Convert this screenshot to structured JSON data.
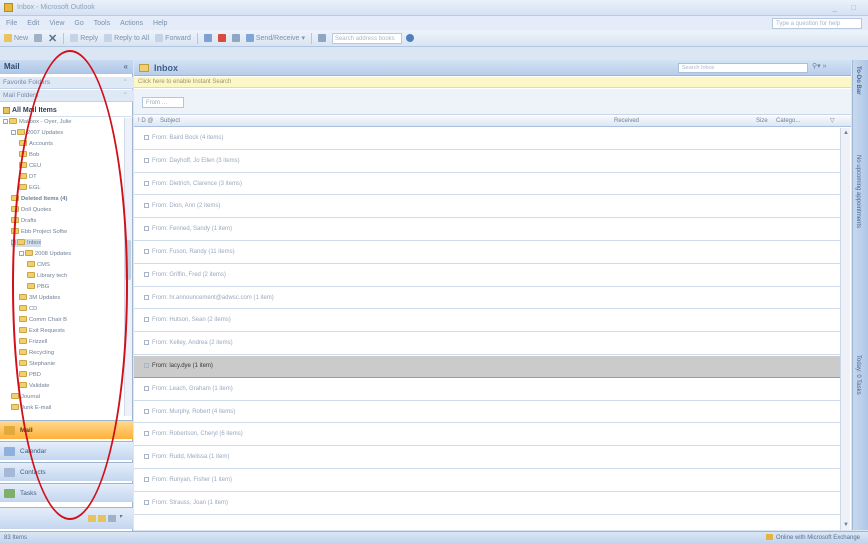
{
  "window": {
    "title": "Inbox - Microsoft Outlook"
  },
  "menu": [
    "File",
    "Edit",
    "View",
    "Go",
    "Tools",
    "Actions",
    "Help"
  ],
  "help_placeholder": "Type a question for help",
  "toolbar": {
    "new": "New",
    "reply": "Reply",
    "reply_all": "Reply to All",
    "forward": "Forward",
    "send_receive": "Send/Receive",
    "search_address_books": "Search address books"
  },
  "nav": {
    "title": "Mail",
    "favorite_folders": "Favorite Folders",
    "mail_folders": "Mail Folders",
    "all_mail_items": "All Mail Items",
    "folders": [
      {
        "label": "Mailbox - Oyer, Julie",
        "indent": 0,
        "toggle": "-"
      },
      {
        "label": "2007 Updates",
        "indent": 1,
        "toggle": "-"
      },
      {
        "label": "Accounts",
        "indent": 2
      },
      {
        "label": "Bob",
        "indent": 2
      },
      {
        "label": "CEU",
        "indent": 2
      },
      {
        "label": "DT",
        "indent": 2
      },
      {
        "label": "EGL",
        "indent": 2
      },
      {
        "label": "Deleted Items (4)",
        "indent": 1,
        "bold": true
      },
      {
        "label": "Doll Quotes",
        "indent": 1
      },
      {
        "label": "Drafts",
        "indent": 1
      },
      {
        "label": "Ebb Project Softw",
        "indent": 1
      },
      {
        "label": "Inbox",
        "indent": 1,
        "toggle": "-",
        "selected": true
      },
      {
        "label": "2008 Updates",
        "indent": 2,
        "toggle": "-"
      },
      {
        "label": "CMS",
        "indent": 3
      },
      {
        "label": "Library tech",
        "indent": 3
      },
      {
        "label": "PBG",
        "indent": 3
      },
      {
        "label": "3M Updates",
        "indent": 2
      },
      {
        "label": "CD",
        "indent": 2
      },
      {
        "label": "Comm Chair B",
        "indent": 2
      },
      {
        "label": "Exit Requests",
        "indent": 2
      },
      {
        "label": "Frizzell",
        "indent": 2
      },
      {
        "label": "Recycling",
        "indent": 2
      },
      {
        "label": "Stephanie",
        "indent": 2
      },
      {
        "label": "PBD",
        "indent": 2
      },
      {
        "label": "Validate",
        "indent": 2
      },
      {
        "label": "Journal",
        "indent": 1
      },
      {
        "label": "Junk E-mail",
        "indent": 1
      }
    ],
    "buttons": [
      "Mail",
      "Calendar",
      "Contacts",
      "Tasks"
    ]
  },
  "inbox": {
    "title": "Inbox",
    "search_placeholder": "Search Inbox",
    "infobar": "Click here to enable Instant Search",
    "filter_from": "From",
    "columns": {
      "icons": "! D @",
      "subject": "Subject",
      "received": "Received",
      "size": "Size",
      "categories": "Catego..."
    },
    "groups": [
      "From: Baird Bock (4 items)",
      "From: Dayhoff, Jo Ellen (3 items)",
      "From: Dietrich, Clarence (3 items)",
      "From: Dion, Ann (2 items)",
      "From: Fenned, Sandy (1 item)",
      "From: Fuson, Randy (11 items)",
      "From: Griffin, Fred (2 items)",
      "From: hr.announcement@adwsc.com (1 item)",
      "From: Hutson, Sean (2 items)",
      "From: Kelley, Andrea (2 items)",
      "From: lacy.dye (1 item)",
      "From: Leach, Graham (1 item)",
      "From: Murphy, Robert (4 items)",
      "From: Robertson, Cheryl (6 items)",
      "From: Rudd, Melissa (1 item)",
      "From: Runyan, Fisher (1 item)",
      "From: Strauss, Joan (1 item)"
    ],
    "selected_group_index": 10
  },
  "todo": {
    "items": [
      "To-Do Bar",
      "No upcoming appointments",
      "Today: 0 Tasks"
    ]
  },
  "status": {
    "left": "83 Items",
    "right": "Online with Microsoft Exchange"
  },
  "colors": {
    "annotation_ellipse": "#d0101a",
    "mail_button": "#ffb03b",
    "selected_row": "#cbcbcb"
  }
}
